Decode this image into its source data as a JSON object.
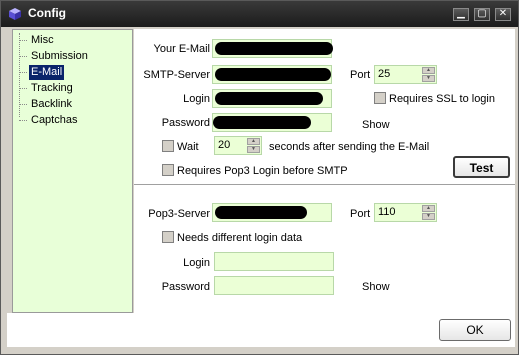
{
  "window": {
    "title": "Config"
  },
  "titlebar": {
    "minimize_glyph": "▁",
    "maximize_glyph": "▢",
    "close_glyph": "✕"
  },
  "sidebar": {
    "items": [
      {
        "label": "Misc"
      },
      {
        "label": "Submission"
      },
      {
        "label": "E-Mail",
        "selected": true
      },
      {
        "label": "Tracking"
      },
      {
        "label": "Backlink"
      },
      {
        "label": "Captchas"
      }
    ]
  },
  "smtp": {
    "your_email_label": "Your E-Mail",
    "smtp_server_label": "SMTP-Server",
    "port_label": "Port",
    "port_value": "25",
    "requires_ssl_label": "Requires SSL to login",
    "login_label": "Login",
    "password_label": "Password",
    "show_label": "Show",
    "wait_label": "Wait",
    "wait_value": "20",
    "wait_suffix": "seconds after sending the E-Mail",
    "pop3_before_smtp_label": "Requires Pop3 Login before SMTP",
    "test_button": "Test"
  },
  "pop3": {
    "server_label": "Pop3-Server",
    "port_label": "Port",
    "port_value": "110",
    "different_login_label": "Needs different login data",
    "login_label": "Login",
    "password_label": "Password",
    "show_label": "Show"
  },
  "footer": {
    "ok_button": "OK"
  },
  "colors": {
    "field_bg": "#ebffd6",
    "tree_bg": "#e8ffd8",
    "selection": "#0a246a",
    "titlebar": "#1b1b1b"
  }
}
